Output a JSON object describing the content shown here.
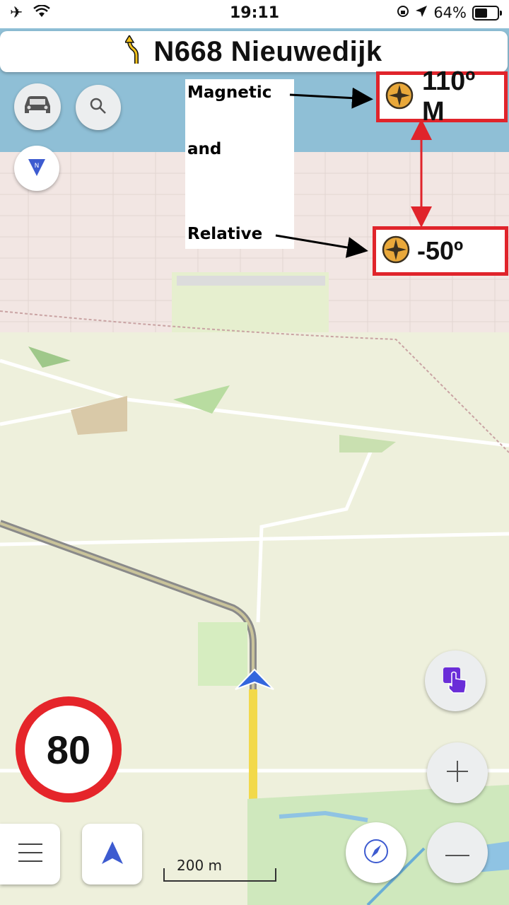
{
  "status_bar": {
    "time": "19:11",
    "battery_percent": "64%",
    "battery_level": 0.64,
    "icons": [
      "airplane-icon",
      "wifi-icon",
      "orientation-lock-icon",
      "location-arrow-icon",
      "battery-icon"
    ]
  },
  "navigation": {
    "street_name": "N668 Nieuwedijk",
    "turn_icon": "turn-arrow-icon"
  },
  "annotation": {
    "line1": "Magnetic",
    "line2": "and",
    "line3": "Relative"
  },
  "compass_readouts": {
    "magnetic": "110º M",
    "relative": "-50º",
    "icon": "compass-rose-icon"
  },
  "speed_limit": "80",
  "scale_bar": "200 m",
  "colors": {
    "annotation_red": "#e0242b",
    "speed_red": "#e5252a",
    "water": "#8fbfd6",
    "route_yellow": "#f2d94a",
    "position_blue": "#3366dd"
  }
}
